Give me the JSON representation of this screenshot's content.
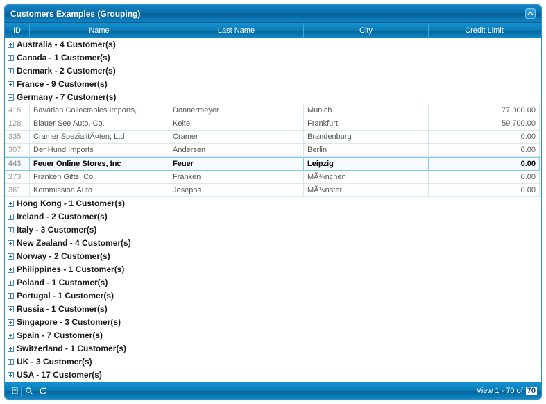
{
  "panel": {
    "title": "Customers Examples (Grouping)"
  },
  "columns": {
    "id": "ID",
    "name": "Name",
    "lname": "Last Name",
    "city": "City",
    "credit": "Credit Limit"
  },
  "groups": [
    {
      "label": "Australia - 4 Customer(s)",
      "expanded": false
    },
    {
      "label": "Canada - 1 Customer(s)",
      "expanded": false
    },
    {
      "label": "Denmark - 2 Customer(s)",
      "expanded": false
    },
    {
      "label": "France - 9 Customer(s)",
      "expanded": false
    },
    {
      "label": "Germany - 7 Customer(s)",
      "expanded": true,
      "rows": [
        {
          "id": "415",
          "name": "Bavarian Collectables Imports,",
          "lname": "Donnermeyer",
          "city": "Munich",
          "credit": "77 000.00",
          "selected": false
        },
        {
          "id": "128",
          "name": "Blauer See Auto, Co.",
          "lname": "Keitel",
          "city": "Frankfurt",
          "credit": "59 700.00",
          "selected": false
        },
        {
          "id": "335",
          "name": "Cramer SpezialitÃ¤ten, Ltd",
          "lname": "Cramer",
          "city": "Brandenburg",
          "credit": "0.00",
          "selected": false
        },
        {
          "id": "307",
          "name": "Der Hund Imports",
          "lname": "Andersen",
          "city": "Berlin",
          "credit": "0.00",
          "selected": false
        },
        {
          "id": "443",
          "name": "Feuer Online Stores, Inc",
          "lname": "Feuer",
          "city": "Leipzig",
          "credit": "0.00",
          "selected": true
        },
        {
          "id": "273",
          "name": "Franken Gifts, Co",
          "lname": "Franken",
          "city": "MÃ¼nchen",
          "credit": "0.00",
          "selected": false
        },
        {
          "id": "361",
          "name": "Kommission Auto",
          "lname": "Josephs",
          "city": "MÃ¼nster",
          "credit": "0.00",
          "selected": false
        }
      ]
    },
    {
      "label": "Hong Kong - 1 Customer(s)",
      "expanded": false
    },
    {
      "label": "Ireland - 2 Customer(s)",
      "expanded": false
    },
    {
      "label": "Italy - 3 Customer(s)",
      "expanded": false
    },
    {
      "label": "New Zealand - 4 Customer(s)",
      "expanded": false
    },
    {
      "label": "Norway - 2 Customer(s)",
      "expanded": false
    },
    {
      "label": "Philippines - 1 Customer(s)",
      "expanded": false
    },
    {
      "label": "Poland - 1 Customer(s)",
      "expanded": false
    },
    {
      "label": "Portugal - 1 Customer(s)",
      "expanded": false
    },
    {
      "label": "Russia - 1 Customer(s)",
      "expanded": false
    },
    {
      "label": "Singapore - 3 Customer(s)",
      "expanded": false
    },
    {
      "label": "Spain - 7 Customer(s)",
      "expanded": false
    },
    {
      "label": "Switzerland - 1 Customer(s)",
      "expanded": false
    },
    {
      "label": "UK - 3 Customer(s)",
      "expanded": false
    },
    {
      "label": "USA - 17 Customer(s)",
      "expanded": false
    }
  ],
  "footer": {
    "view_prefix": "View 1 - 70 of",
    "total": "70"
  }
}
